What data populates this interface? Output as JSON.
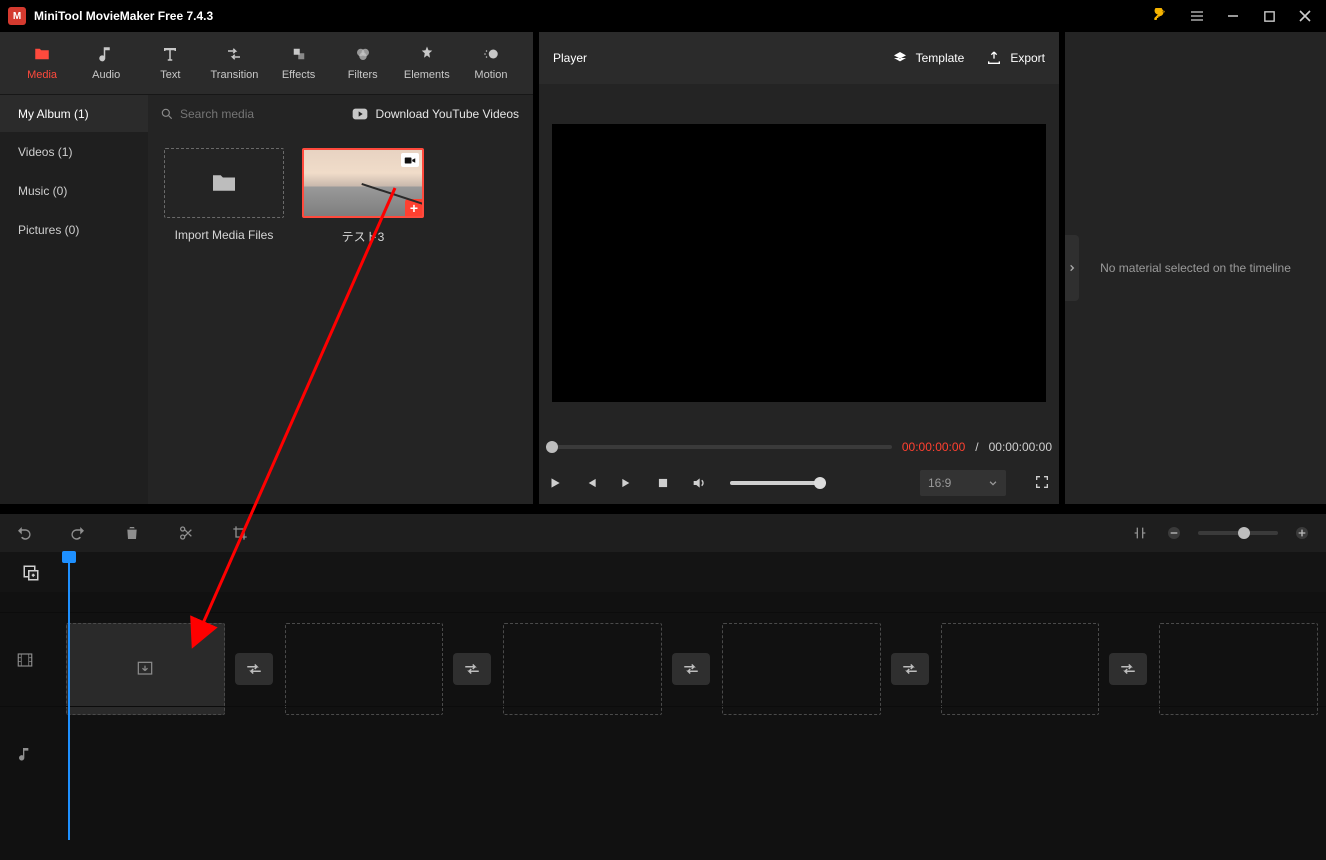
{
  "titlebar": {
    "app_title": "MiniTool MovieMaker Free 7.4.3"
  },
  "tabs": {
    "media": "Media",
    "audio": "Audio",
    "text": "Text",
    "transition": "Transition",
    "effects": "Effects",
    "filters": "Filters",
    "elements": "Elements",
    "motion": "Motion"
  },
  "album": {
    "my_album": "My Album (1)",
    "search_placeholder": "Search media",
    "download_yt": "Download YouTube Videos",
    "side": {
      "videos": "Videos (1)",
      "music": "Music (0)",
      "pictures": "Pictures (0)"
    },
    "import_caption": "Import Media Files",
    "clip1_name": "テスト3"
  },
  "player": {
    "title": "Player",
    "template": "Template",
    "export": "Export",
    "time_current": "00:00:00:00",
    "time_sep": "/",
    "time_total": "00:00:00:00",
    "ratio": "16:9"
  },
  "right": {
    "placeholder": "No material selected on the timeline"
  }
}
